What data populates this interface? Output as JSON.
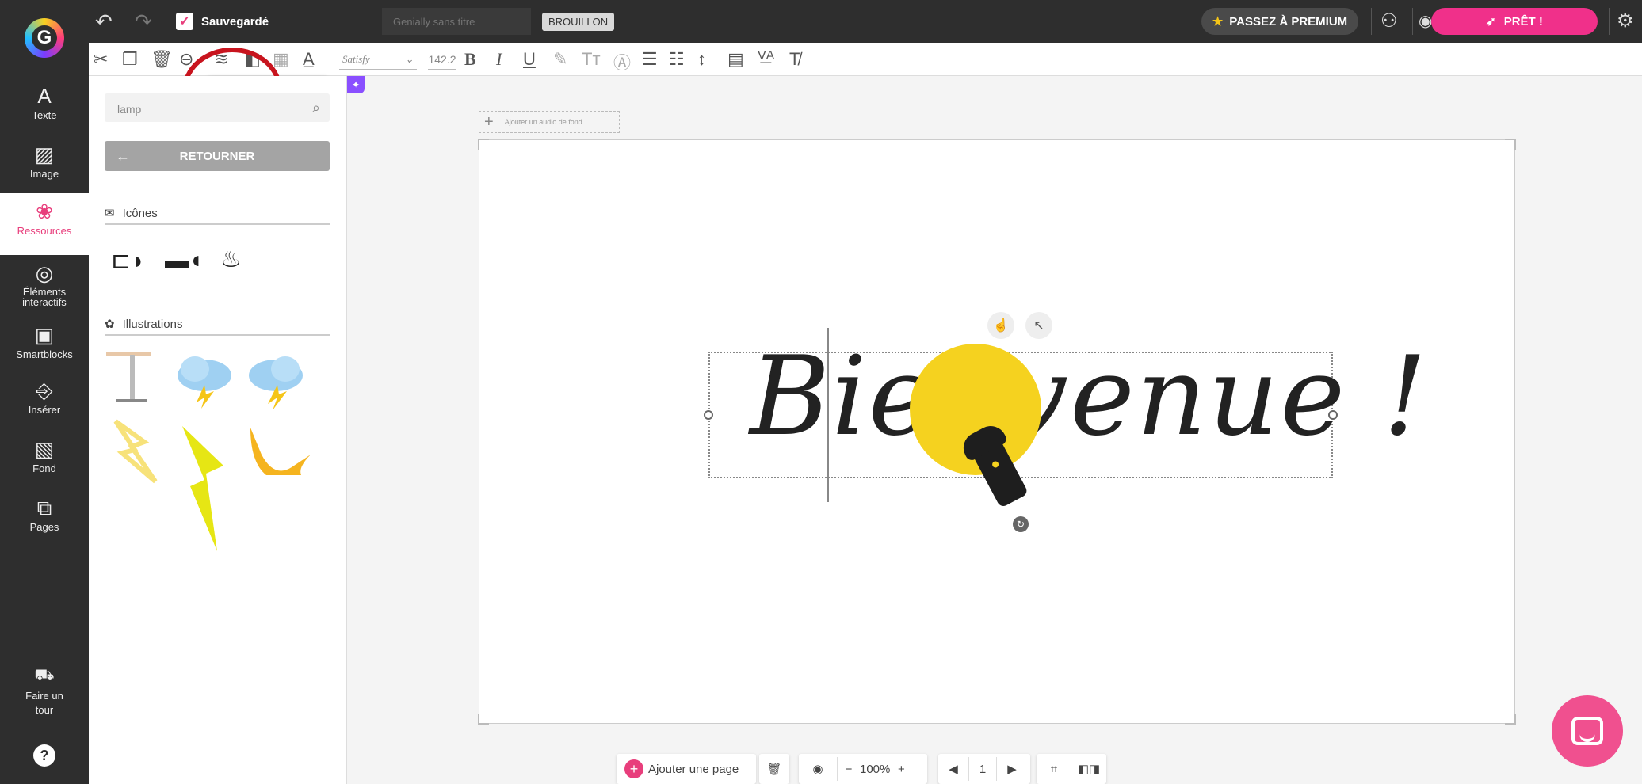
{
  "topbar": {
    "logo_letter": "G",
    "saved_label": "Sauvegardé",
    "title_placeholder": "Genially sans titre",
    "draft_badge": "BROUILLON",
    "premium_label": "PASSEZ À PREMIUM",
    "ready_label": "PRÊT !"
  },
  "toolbar": {
    "font_name": "Satisfy",
    "font_size": "142.2"
  },
  "sidebar": {
    "items": [
      {
        "label": "Texte"
      },
      {
        "label": "Image"
      },
      {
        "label": "Ressources"
      },
      {
        "label": "Éléments interactifs"
      },
      {
        "label": "Smartblocks"
      },
      {
        "label": "Insérer"
      },
      {
        "label": "Fond"
      },
      {
        "label": "Pages"
      }
    ],
    "tour_label": "Faire un tour",
    "help_label": "?"
  },
  "panel": {
    "search_value": "lamp",
    "back_label": "RETOURNER",
    "icons_heading": "Icônes",
    "illustrations_heading": "Illustrations"
  },
  "canvas": {
    "audio_label": "Ajouter un audio de fond",
    "welcome_text": "Bienvenue !"
  },
  "bottom": {
    "add_page_label": "Ajouter une page",
    "zoom": "100%",
    "page_number": "1"
  },
  "colors": {
    "accent": "#f0308a",
    "dark": "#2e2e2e",
    "sun": "#f5d21f"
  }
}
